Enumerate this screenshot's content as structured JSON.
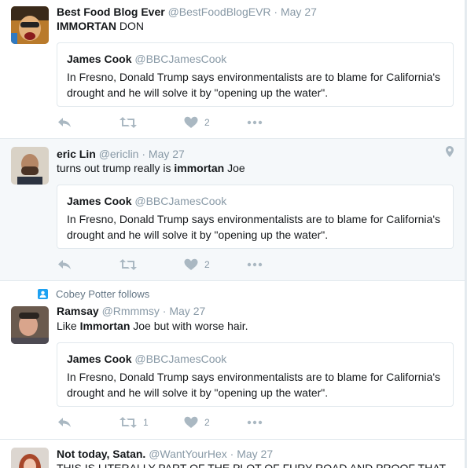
{
  "tweets": [
    {
      "name": "Best Food Blog Ever",
      "handle": "@BestFoodBlogEVR",
      "date": "May 27",
      "text_bold": "IMMORTAN",
      "text_rest": " DON",
      "quote": {
        "name": "James Cook",
        "handle": "@BBCJamesCook",
        "text": "In Fresno, Donald Trump says environmentalists are to blame for California's drought and he will solve it by \"opening up the water\"."
      },
      "retweets": "",
      "likes": "2"
    },
    {
      "name": "eric Lin",
      "handle": "@ericlin",
      "date": "May 27",
      "text_pre": "turns out trump really is ",
      "text_bold": "immortan",
      "text_post": " Joe",
      "quote": {
        "name": "James Cook",
        "handle": "@BBCJamesCook",
        "text": "In Fresno, Donald Trump says environmentalists are to blame for California's drought and he will solve it by \"opening up the water\"."
      },
      "retweets": "",
      "likes": "2"
    },
    {
      "context": "Cobey Potter follows",
      "name": "Ramsay",
      "handle": "@Rmmmsy",
      "date": "May 27",
      "text_pre": "Like ",
      "text_bold": "Immortan",
      "text_post": " Joe but with worse hair.",
      "quote": {
        "name": "James Cook",
        "handle": "@BBCJamesCook",
        "text": "In Fresno, Donald Trump says environmentalists are to blame for California's drought and he will solve it by \"opening up the water\"."
      },
      "retweets": "1",
      "likes": "2"
    },
    {
      "name": "Not today, Satan.",
      "handle": "@WantYourHex",
      "date": "May 27",
      "text": "THIS IS LITERALLY PART OF THE PLOT OF FURY ROAD AND PROOF THAT"
    }
  ],
  "dot": "·",
  "colors": {
    "accent": "#1da1f2",
    "muted": "#8899a6",
    "icon": "#aab8c2",
    "border": "#e1e8ed",
    "alt_bg": "#f5f8fa"
  },
  "icons": [
    "reply-icon",
    "retweet-icon",
    "like-icon",
    "more-icon",
    "location-icon",
    "follow-icon"
  ]
}
